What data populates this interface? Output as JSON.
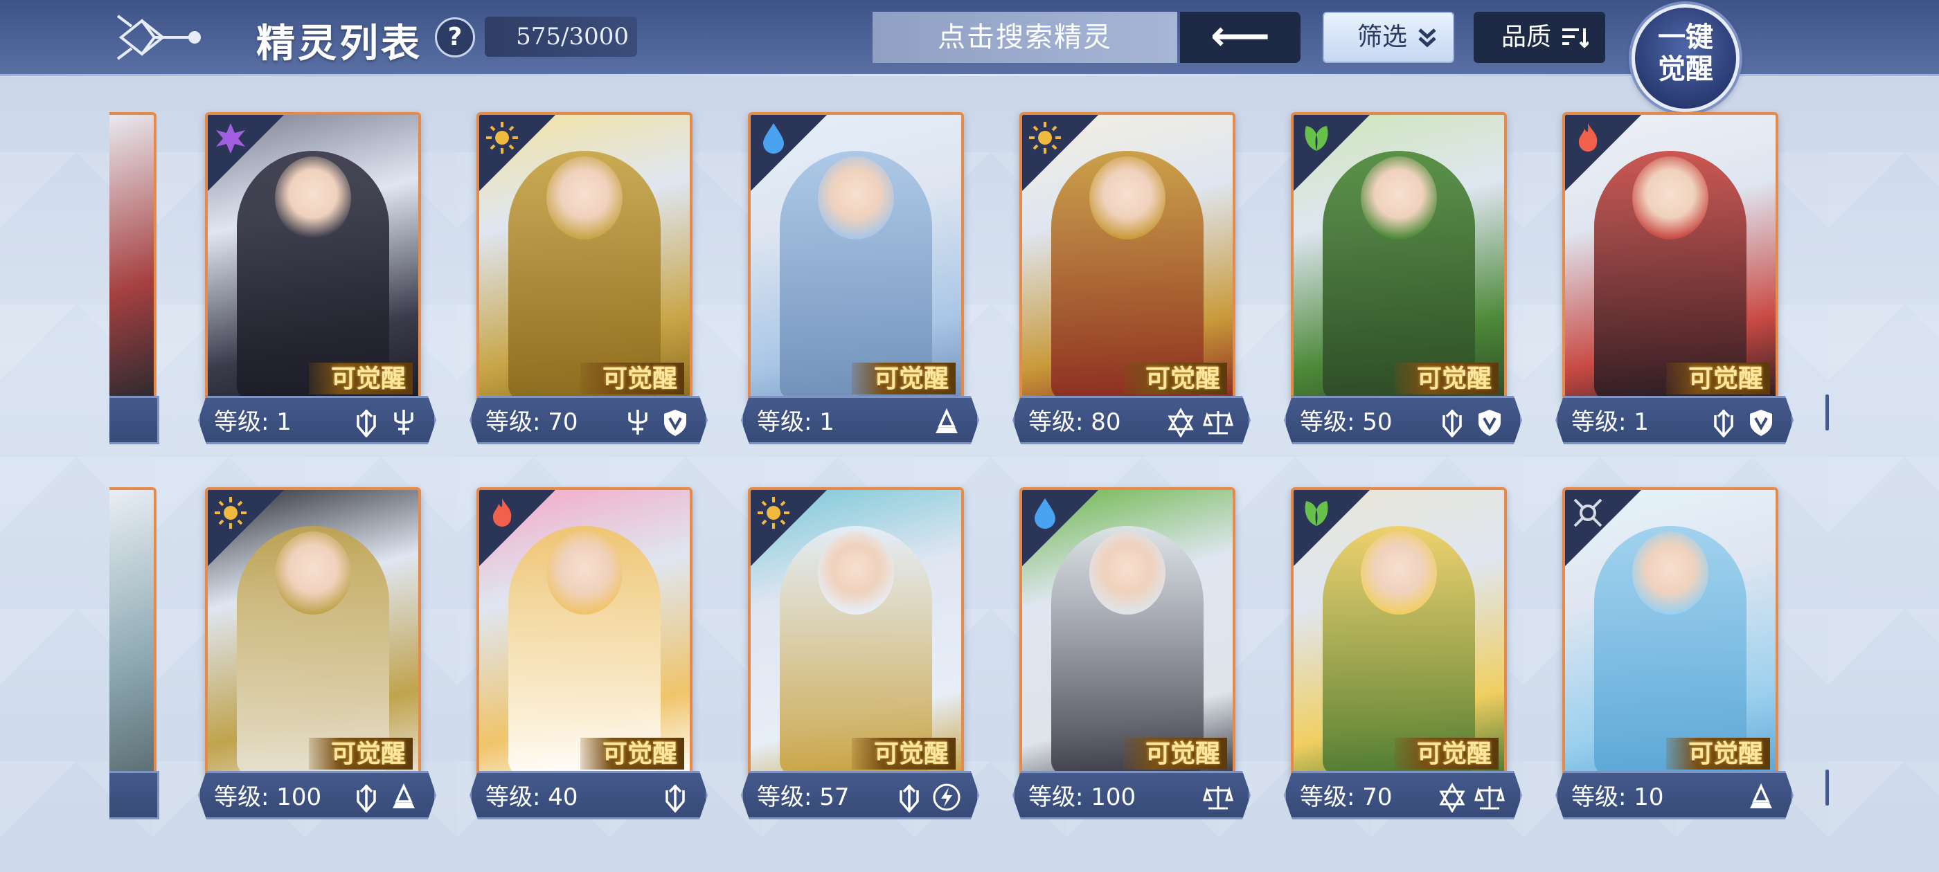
{
  "header": {
    "title": "精灵列表",
    "help_label": "?",
    "count": "575/3000",
    "search_placeholder": "点击搜索精灵",
    "back_label": "⟵",
    "filter_label": "筛选",
    "quality_label": "品质",
    "awaken_all_line1": "一键",
    "awaken_all_line2": "觉醒"
  },
  "awaken_tag": "可觉醒",
  "cards_row1": [
    {
      "level": "等级: 1",
      "element": "dark",
      "element_color": "#a35fe0",
      "palette": [
        "#3a3a4a",
        "#7c7f92",
        "#1b1c26"
      ],
      "skills": [
        "sword-shield-icon",
        "trident-icon"
      ]
    },
    {
      "level": "等级: 70",
      "element": "light",
      "element_color": "#f1b93d",
      "palette": [
        "#c8a547",
        "#f3e3a0",
        "#8a6a1e"
      ],
      "skills": [
        "trident-icon",
        "shield-icon"
      ]
    },
    {
      "level": "等级: 1",
      "element": "water",
      "element_color": "#4aa3f0",
      "palette": [
        "#a9c6e6",
        "#e4eef9",
        "#6f8fb8"
      ],
      "skills": [
        "book-icon"
      ]
    },
    {
      "level": "等级: 80",
      "element": "light",
      "element_color": "#f1b93d",
      "palette": [
        "#c99a3a",
        "#f4efe1",
        "#8a2a22"
      ],
      "skills": [
        "star-icon",
        "scale-icon"
      ]
    },
    {
      "level": "等级: 50",
      "element": "grass",
      "element_color": "#67c24a",
      "palette": [
        "#4e8a3a",
        "#cfe6b8",
        "#2e4a28"
      ],
      "skills": [
        "sword-shield-icon",
        "shield-icon"
      ]
    },
    {
      "level": "等级: 1",
      "element": "fire",
      "element_color": "#f0604a",
      "palette": [
        "#c94a44",
        "#eef0f6",
        "#2a1d24"
      ],
      "skills": [
        "sword-shield-icon",
        "shield-icon"
      ]
    }
  ],
  "cards_row2": [
    {
      "level": "等级: 100",
      "element": "light",
      "element_color": "#f1b93d",
      "palette": [
        "#c0a34d",
        "#2d2e36",
        "#e8e3d5"
      ],
      "skills": [
        "sword-shield-icon",
        "book-icon"
      ]
    },
    {
      "level": "等级: 40",
      "element": "fire",
      "element_color": "#f0604a",
      "palette": [
        "#f0c46a",
        "#f4a8c4",
        "#ffffff"
      ],
      "skills": [
        "sword-shield-icon"
      ]
    },
    {
      "level": "等级: 57",
      "element": "light",
      "element_color": "#f1b93d",
      "palette": [
        "#e7eef8",
        "#7bc8d8",
        "#c9a23e"
      ],
      "skills": [
        "sword-shield-icon",
        "lightning-icon"
      ]
    },
    {
      "level": "等级: 100",
      "element": "water",
      "element_color": "#4aa3f0",
      "palette": [
        "#dfe4ea",
        "#6db74a",
        "#3a3a44"
      ],
      "skills": [
        "scale-icon"
      ]
    },
    {
      "level": "等级: 70",
      "element": "grass",
      "element_color": "#67c24a",
      "palette": [
        "#f0cf62",
        "#e9e6d6",
        "#4a7a32"
      ],
      "skills": [
        "star-icon",
        "scale-icon"
      ]
    },
    {
      "level": "等级: 10",
      "element": "neutral",
      "element_color": "#d6dbe6",
      "palette": [
        "#9bd0ee",
        "#e6f4fb",
        "#5aa6d6"
      ],
      "skills": [
        "book-icon"
      ]
    }
  ]
}
